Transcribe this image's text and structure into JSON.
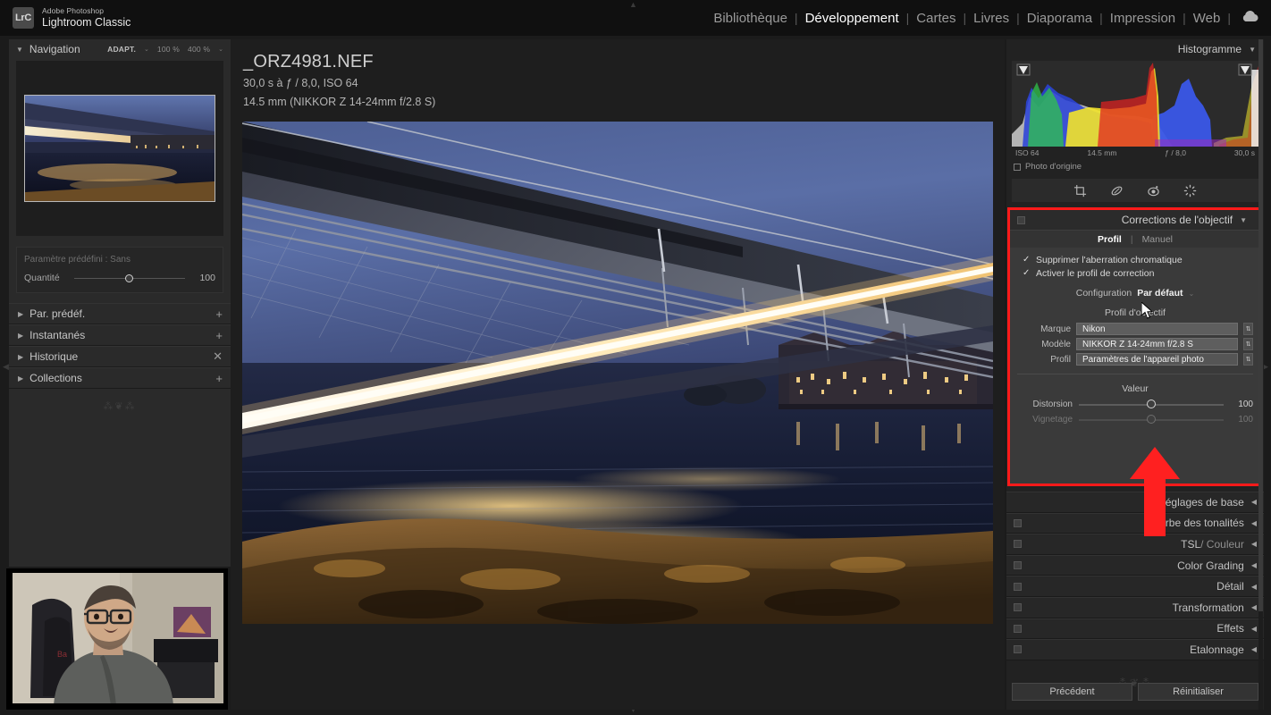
{
  "app": {
    "brand_small": "Adobe Photoshop",
    "brand_name": "Lightroom Classic",
    "logo_text": "LrC"
  },
  "modules": [
    {
      "label": "Bibliothèque",
      "active": false
    },
    {
      "label": "Développement",
      "active": true
    },
    {
      "label": "Cartes",
      "active": false
    },
    {
      "label": "Livres",
      "active": false
    },
    {
      "label": "Diaporama",
      "active": false
    },
    {
      "label": "Impression",
      "active": false
    },
    {
      "label": "Web",
      "active": false
    }
  ],
  "left_panel": {
    "navigator": {
      "title": "Navigation",
      "fit_label": "ADAPT.",
      "zoom_1": "100 %",
      "zoom_2": "400 %"
    },
    "preset": {
      "label": "Paramètre prédéfini : Sans",
      "quantity_label": "Quantité",
      "quantity_value": "100",
      "quantity_pct": 46
    },
    "items": [
      {
        "label": "Par. prédéf.",
        "action": "+"
      },
      {
        "label": "Instantanés",
        "action": "+"
      },
      {
        "label": "Historique",
        "action": "✕"
      },
      {
        "label": "Collections",
        "action": "+"
      }
    ]
  },
  "center": {
    "filename": "_ORZ4981.NEF",
    "exposure_line": "30,0 s à ƒ / 8,0, ISO 64",
    "lens_line": "14.5 mm (NIKKOR Z 14-24mm f/2.8 S)"
  },
  "right_panel": {
    "histogram": {
      "title": "Histogramme",
      "iso": "ISO 64",
      "focal": "14.5 mm",
      "aperture": "ƒ / 8,0",
      "shutter": "30,0 s",
      "original_label": "Photo d'origine"
    },
    "tools": [
      {
        "name": "crop-tool"
      },
      {
        "name": "healing-brush-tool"
      },
      {
        "name": "red-eye-tool"
      },
      {
        "name": "masking-tool"
      }
    ],
    "lens_panel": {
      "title": "Corrections de l'objectif",
      "tab_profile": "Profil",
      "tab_manual": "Manuel",
      "check_chromatic": "Supprimer l'aberration chromatique",
      "check_enable_profile": "Activer le profil de correction",
      "config_label": "Configuration",
      "config_value": "Par défaut",
      "profile_section_title": "Profil d'objectif",
      "brand_label": "Marque",
      "brand_value": "Nikon",
      "model_label": "Modèle",
      "model_value": "NIKKOR Z 14-24mm f/2.8 S",
      "profile_label": "Profil",
      "profile_value": "Paramètres de l'appareil photo",
      "value_section_title": "Valeur",
      "distortion_label": "Distorsion",
      "distortion_value": "100",
      "distortion_pct": 50,
      "vignetting_label": "Vignetage",
      "vignetting_value": "100",
      "vignetting_pct": 50
    },
    "sections": [
      {
        "label": "Réglages de base",
        "switch": false
      },
      {
        "label": "Courbe des tonalités",
        "switch": true
      },
      {
        "label": "TSL",
        "label2": "/ Couleur",
        "switch": true
      },
      {
        "label": "Color Grading",
        "switch": true
      },
      {
        "label": "Détail",
        "switch": true
      },
      {
        "label": "Transformation",
        "switch": true
      },
      {
        "label": "Effets",
        "switch": true
      },
      {
        "label": "Etalonnage",
        "switch": true
      }
    ],
    "buttons": {
      "previous": "Précédent",
      "reset": "Réinitialiser"
    }
  },
  "colors": {
    "highlight_red": "#ff1a1a",
    "arrow_red": "#ff2020",
    "panel_bg": "#222222",
    "lens_body": "#3a3a3a"
  }
}
